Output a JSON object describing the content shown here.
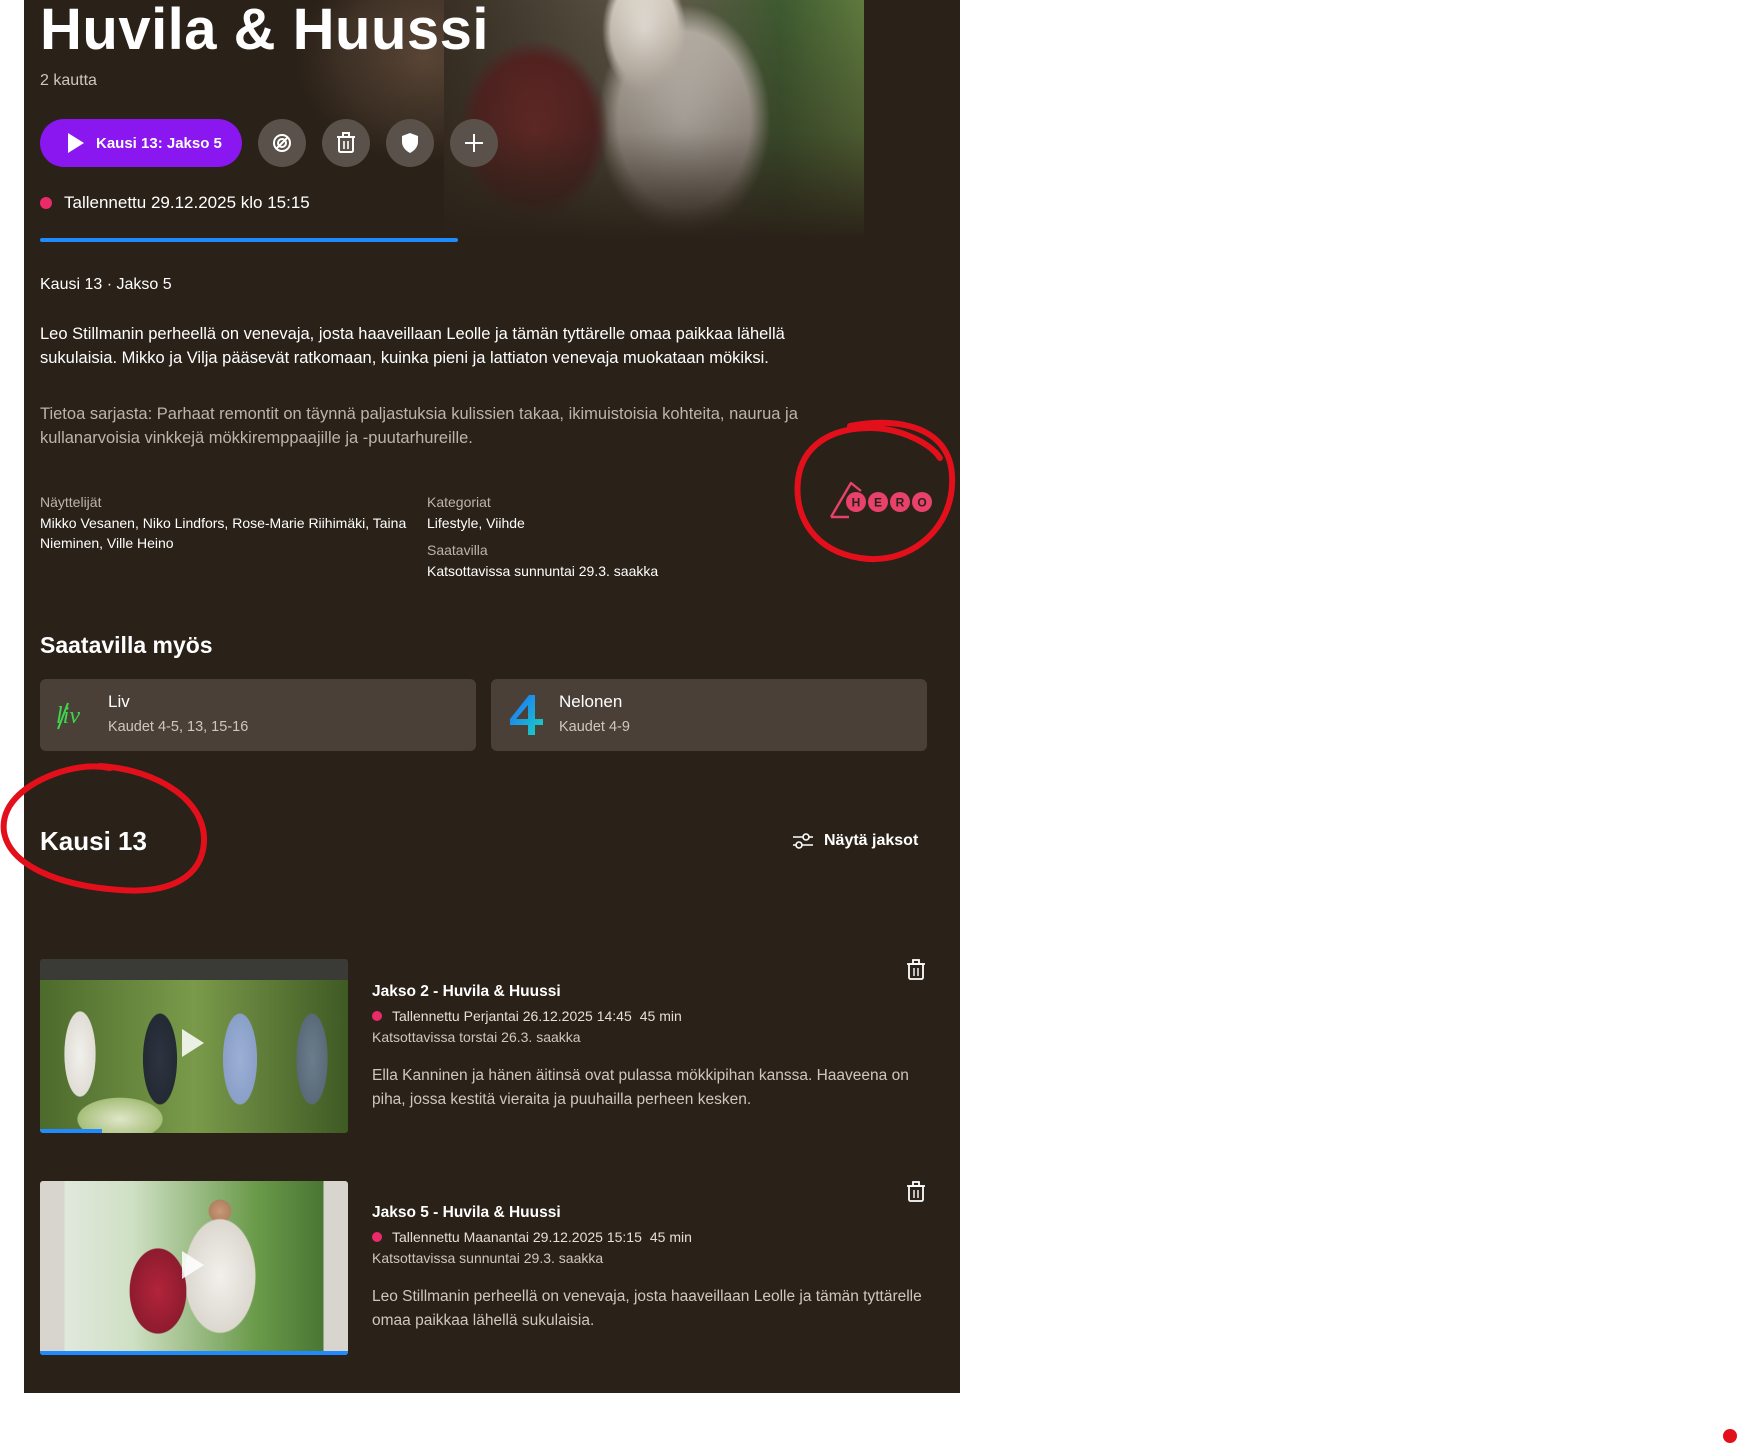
{
  "show": {
    "title": "Huvila & Huussi",
    "seasons_count": "2 kautta",
    "play_label": "Kausi 13: Jakso 5",
    "recorded": "Tallennettu 29.12.2025 klo 15:15",
    "watch_progress": 0.47,
    "episode_label": "Kausi 13 · Jakso 5",
    "description": "Leo Stillmanin perheellä on venevaja, josta haaveillaan Leolle ja tämän tyttärelle omaa paikkaa lähellä sukulaisia. Mikko ja Vilja pääsevät ratkomaan, kuinka pieni ja lattiaton venevaja muokataan mökiksi.",
    "about": "Tietoa sarjasta: Parhaat remontit on täynnä paljastuksia kulissien takaa, ikimuistoisia kohteita, naurua ja kullanarvoisia vinkkejä mökkiremppaajille ja -puutarhureille.",
    "actors_label": "Näyttelijät",
    "actors": "Mikko Vesanen, Niko Lindfors, Rose-Marie Riihimäki, Taina Nieminen, Ville Heino",
    "categories_label": "Kategoriat",
    "categories": "Lifestyle, Viihde",
    "availability_label": "Saatavilla",
    "availability": "Katsottavissa sunnuntai 29.3. saakka",
    "channel_logo_text": "HERO"
  },
  "also_available": {
    "title": "Saatavilla myös",
    "items": [
      {
        "name": "Liv",
        "sub": "Kaudet 4-5, 13, 15-16",
        "logo": "liv"
      },
      {
        "name": "Nelonen",
        "sub": "Kaudet 4-9",
        "logo": "4"
      }
    ]
  },
  "season": {
    "title": "Kausi 13",
    "show_episodes": "Näytä jaksot",
    "episodes": [
      {
        "title": "Jakso 2 - Huvila & Huussi",
        "recorded": "Tallennettu Perjantai 26.12.2025 14:45",
        "duration": "45 min",
        "available": "Katsottavissa torstai 26.3. saakka",
        "description": "Ella Kanninen ja hänen äitinsä ovat pulassa mökkipihan kanssa. Haaveena on piha, jossa kestitä vieraita ja puuhailla perheen kesken.",
        "progress": 0.2
      },
      {
        "title": "Jakso 5 - Huvila & Huussi",
        "recorded": "Tallennettu Maanantai 29.12.2025 15:15",
        "duration": "45 min",
        "available": "Katsottavissa sunnuntai 29.3. saakka",
        "description": "Leo Stillmanin perheellä on venevaja, josta haaveillaan Leolle ja tämän tyttärelle omaa paikkaa lähellä sukulaisia.",
        "progress": 1.0
      }
    ]
  },
  "colors": {
    "accent": "#8a16f0",
    "background": "#2a2118",
    "record_dot": "#ea2a6a",
    "progress": "#1f8bff",
    "annotation": "#e3101c"
  }
}
